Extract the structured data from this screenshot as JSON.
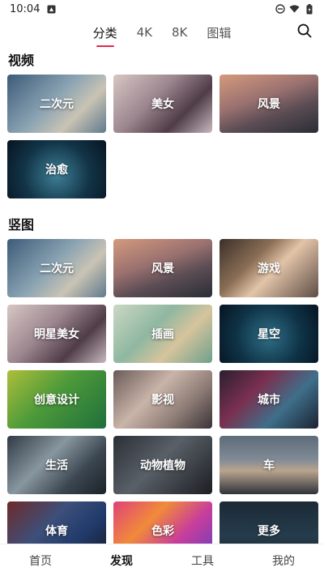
{
  "status_bar": {
    "time": "10:04"
  },
  "top_tabs": [
    {
      "label": "分类",
      "active": true
    },
    {
      "label": "4K",
      "active": false
    },
    {
      "label": "8K",
      "active": false
    },
    {
      "label": "图辑",
      "active": false
    }
  ],
  "sections": {
    "video": {
      "title": "视频",
      "items": [
        {
          "label": "二次元",
          "bg": "linear-gradient(135deg,#3c5b78 0%,#8aa3b3 45%,#c9c3b4 70%,#5f7a8d 100%)"
        },
        {
          "label": "美女",
          "bg": "linear-gradient(135deg,#d7c7c3 0%,#9d8790 40%,#4f3c46 70%,#c8b8c0 100%)"
        },
        {
          "label": "风景",
          "bg": "linear-gradient(160deg,#d49a7c 0%,#9a7170 40%,#5c4d54 65%,#2a2d36 100%)"
        },
        {
          "label": "治愈",
          "bg": "radial-gradient(circle at 50% 60%,#3e7f96 0%,#123447 55%,#071421 100%)"
        }
      ]
    },
    "vertical": {
      "title": "竖图",
      "items": [
        {
          "label": "二次元",
          "bg": "linear-gradient(135deg,#3c5b78 0%,#8aa3b3 45%,#c9c3b4 70%,#5f7a8d 100%)"
        },
        {
          "label": "风景",
          "bg": "linear-gradient(160deg,#d49a7c 0%,#9a7170 40%,#5c4d54 65%,#2a2d36 100%)"
        },
        {
          "label": "游戏",
          "bg": "linear-gradient(135deg,#3b2f2a 0%,#8a6e55 35%,#e2c4a8 55%,#5e4c46 100%)"
        },
        {
          "label": "明星美女",
          "bg": "linear-gradient(135deg,#d7c7c3 0%,#9d8790 40%,#4f3c46 70%,#c8b8c0 100%)"
        },
        {
          "label": "插画",
          "bg": "linear-gradient(135deg,#cbd8c3 0%,#8fb7a1 40%,#d6c49c 65%,#6ea08c 100%)"
        },
        {
          "label": "星空",
          "bg": "radial-gradient(circle at 50% 55%,#2f6f88 0%,#0f3346 55%,#061422 100%)"
        },
        {
          "label": "创意设计",
          "bg": "linear-gradient(135deg,#aebe3a 0%,#4d9a3a 45%,#1f6f3b 100%)"
        },
        {
          "label": "影视",
          "bg": "linear-gradient(135deg,#6a5a58 0%,#c9b4a8 40%,#8c7a74 70%,#3b3236 100%)"
        },
        {
          "label": "城市",
          "bg": "linear-gradient(135deg,#2a1f2e 0%,#7a3050 35%,#3e6f8a 65%,#1c2230 100%)"
        },
        {
          "label": "生活",
          "bg": "linear-gradient(135deg,#2f3a44 0%,#8896a0 40%,#3b4650 70%,#1b222a 100%)"
        },
        {
          "label": "动物植物",
          "bg": "linear-gradient(135deg,#2b2f36 0%,#5a6068 45%,#1b1d22 100%)"
        },
        {
          "label": "车",
          "bg": "linear-gradient(180deg,#5e6b78 0%,#7f8a96 40%,#b9a48e 60%,#2e333a 100%)"
        },
        {
          "label": "体育",
          "bg": "linear-gradient(135deg,#6e2a2a 0%,#3d4f7a 40%,#203a6a 70%,#1a1c2a 100%)"
        },
        {
          "label": "色彩",
          "bg": "linear-gradient(135deg,#e04178 0%,#f18a3a 35%,#c83e9a 65%,#6a3fbf 100%)"
        },
        {
          "label": "更多",
          "bg": "linear-gradient(180deg,#1b2a36 0%,#263c4c 60%,#18222c 100%)"
        }
      ]
    }
  },
  "bottom_nav": [
    {
      "label": "首页",
      "active": false
    },
    {
      "label": "发现",
      "active": true
    },
    {
      "label": "工具",
      "active": false
    },
    {
      "label": "我的",
      "active": false
    }
  ],
  "colors": {
    "accent": "#e0284f"
  },
  "icons": {
    "search": "search-icon"
  }
}
